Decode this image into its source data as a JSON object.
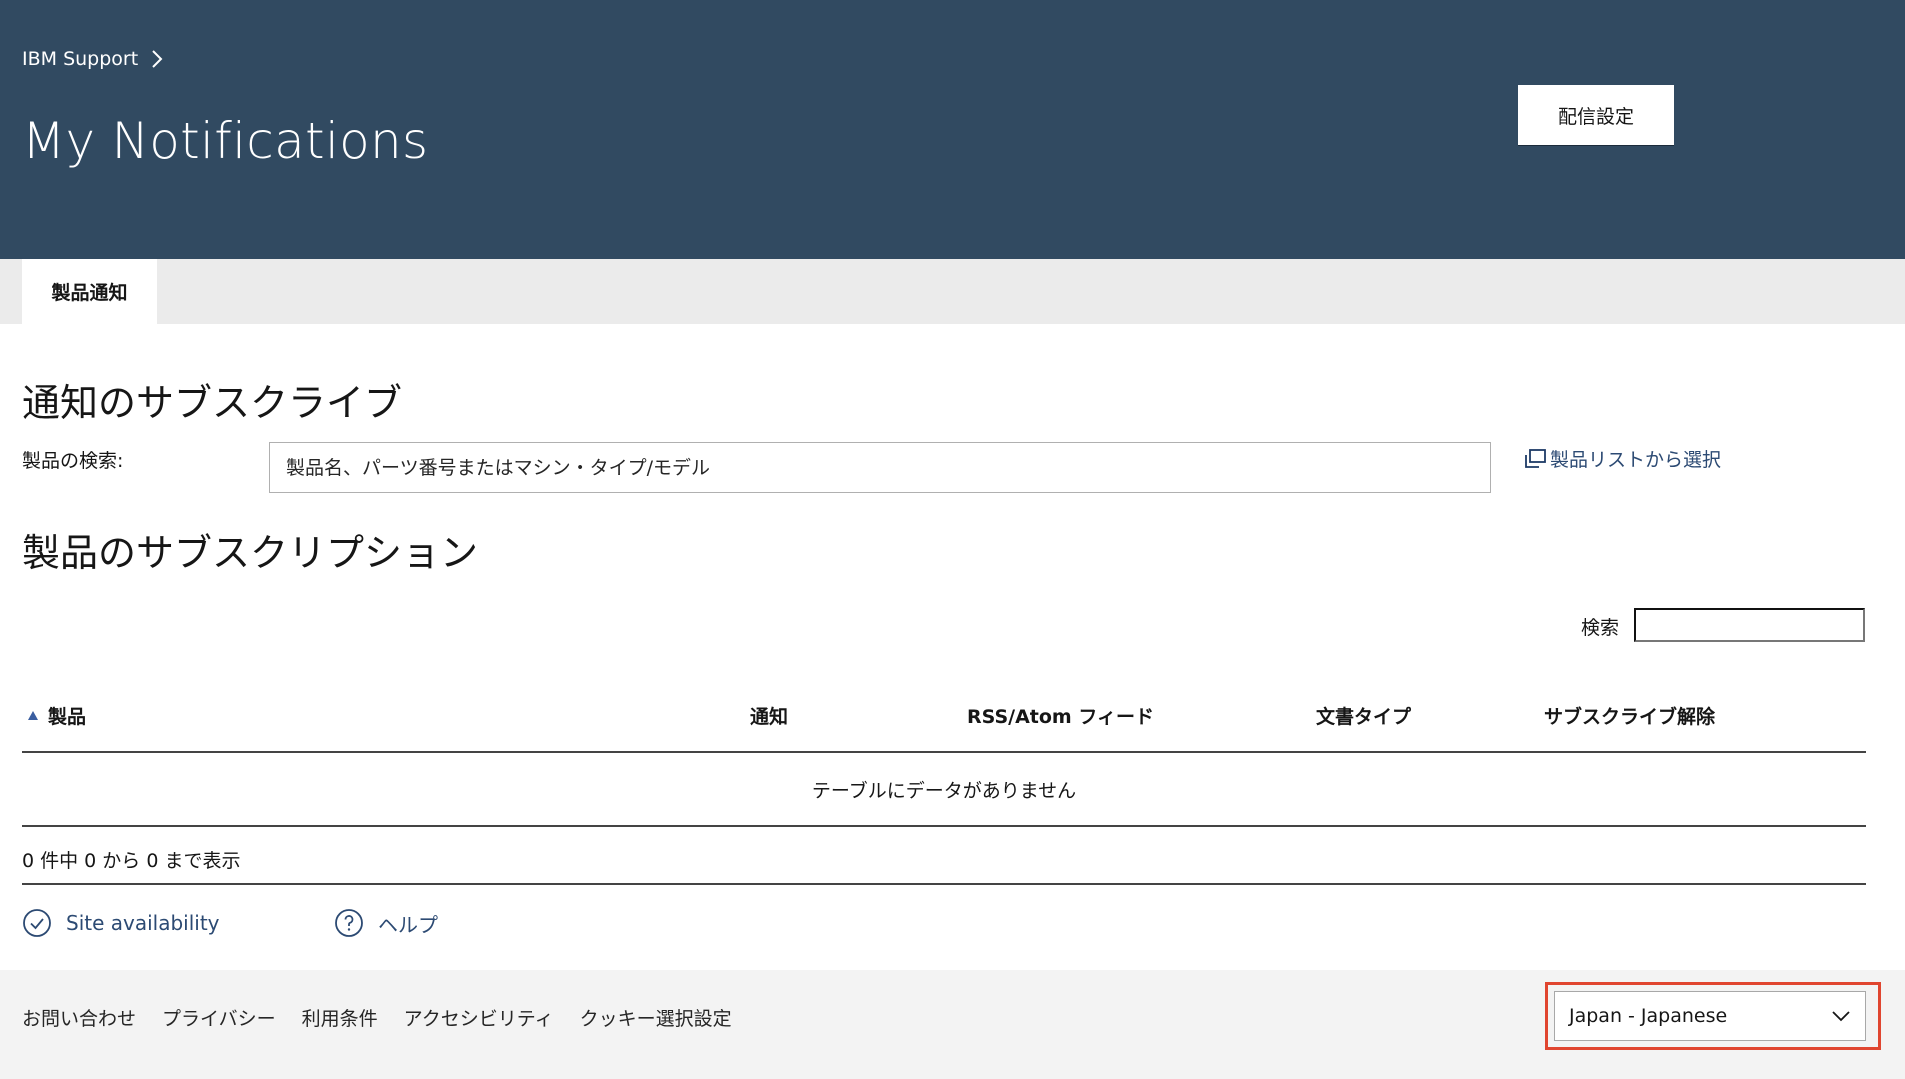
{
  "header": {
    "breadcrumb": "IBM Support",
    "title": "My Notifications",
    "delivery_button": "配信設定",
    "bg_color": "#314a61"
  },
  "tabs": [
    {
      "label": "製品通知",
      "active": true
    }
  ],
  "subscribe": {
    "heading": "通知のサブスクライブ",
    "search_label": "製品の検索:",
    "search_placeholder": "製品名、パーツ番号またはマシン・タイプ/モデル",
    "search_value": "",
    "list_link": "製品リストから選択"
  },
  "subscriptions": {
    "heading": "製品のサブスクリプション",
    "search_label": "検索",
    "search_value": "",
    "columns": [
      {
        "label": "製品",
        "sorted": "asc"
      },
      {
        "label": "通知"
      },
      {
        "label": "RSS/Atom フィード"
      },
      {
        "label": "文書タイプ"
      },
      {
        "label": "サブスクライブ解除"
      }
    ],
    "rows": [],
    "empty_message": "テーブルにデータがありません",
    "info": "0 件中 0 から 0 まで表示"
  },
  "utility_links": [
    {
      "label": "Site availability",
      "icon": "check-circle-icon"
    },
    {
      "label": "ヘルプ",
      "icon": "help-circle-icon"
    }
  ],
  "footer": {
    "links": [
      "お問い合わせ",
      "プライバシー",
      "利用条件",
      "アクセシビリティ",
      "クッキー選択設定"
    ],
    "language": "Japan - Japanese",
    "highlight_color": "#e0452f"
  },
  "colors": {
    "link": "#2c4a73",
    "tabbar": "#ebebeb",
    "footer": "#f3f3f3"
  }
}
